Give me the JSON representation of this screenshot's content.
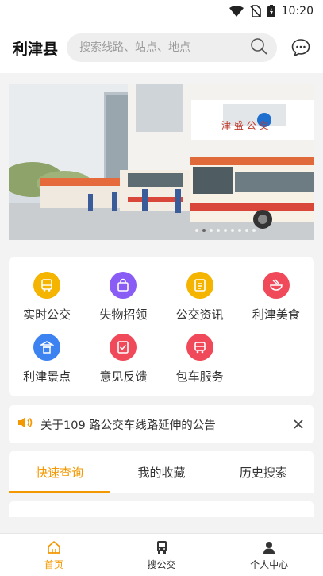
{
  "status": {
    "time": "10:20"
  },
  "header": {
    "city": "利津县",
    "search_placeholder": "搜索线路、站点、地点"
  },
  "banner": {
    "slide_count": 9,
    "active_index": 1
  },
  "services": [
    {
      "label": "实时公交",
      "color": "#f5b400"
    },
    {
      "label": "失物招领",
      "color": "#8a5cf6"
    },
    {
      "label": "公交资讯",
      "color": "#f5b400"
    },
    {
      "label": "利津美食",
      "color": "#f04a5a"
    },
    {
      "label": "利津景点",
      "color": "#3c82f0"
    },
    {
      "label": "意见反馈",
      "color": "#f04a5a"
    },
    {
      "label": "包车服务",
      "color": "#f04a5a"
    }
  ],
  "notice": {
    "text": "关于109 路公交车线路延伸的公告"
  },
  "tabs": [
    {
      "label": "快速查询"
    },
    {
      "label": "我的收藏"
    },
    {
      "label": "历史搜索"
    }
  ],
  "bottom_nav": [
    {
      "label": "首页"
    },
    {
      "label": "搜公交"
    },
    {
      "label": "个人中心"
    }
  ],
  "colors": {
    "accent": "#f39800"
  }
}
